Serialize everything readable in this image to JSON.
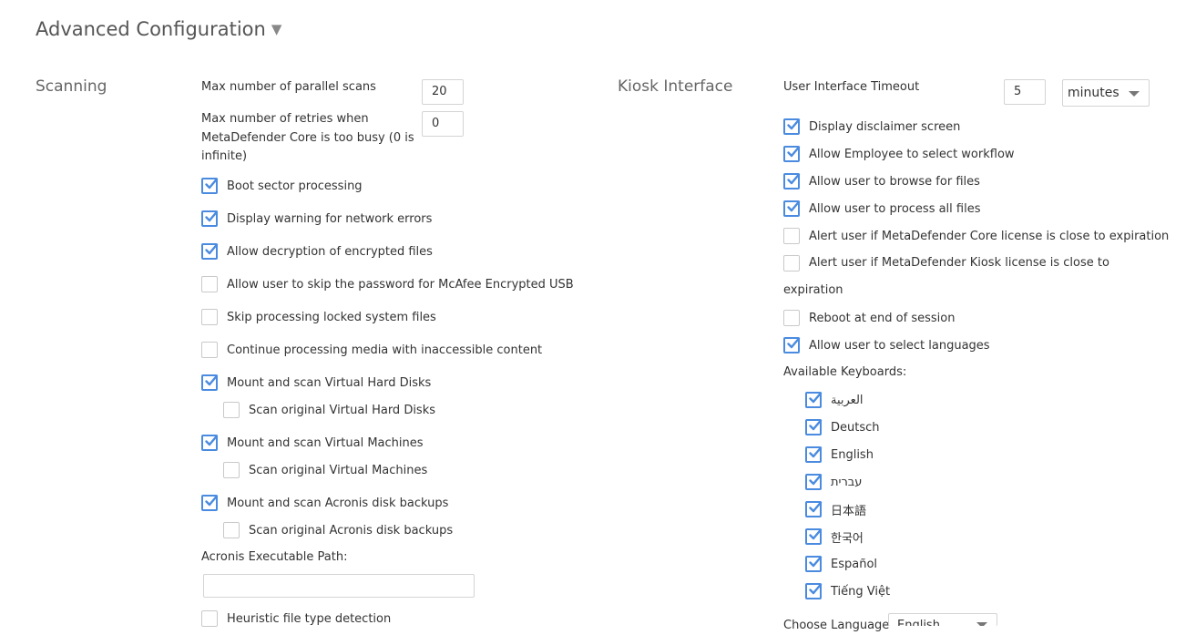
{
  "page": {
    "title": "Advanced Configuration",
    "title_caret": "▼"
  },
  "scanning": {
    "heading": "Scanning",
    "parallel_label": "Max number of parallel scans",
    "parallel_value": "20",
    "retries_label": "Max number of retries when MetaDefender Core is too busy (0 is infinite)",
    "retries_value": "0",
    "options": [
      {
        "label": "Boot sector processing",
        "checked": true
      },
      {
        "label": "Display warning for network errors",
        "checked": true
      },
      {
        "label": "Allow decryption of encrypted files",
        "checked": true
      },
      {
        "label": "Allow user to skip the password for McAfee Encrypted USB",
        "checked": false
      },
      {
        "label": "Skip processing locked system files",
        "checked": false
      },
      {
        "label": "Continue processing media with inaccessible content",
        "checked": false
      },
      {
        "label": "Mount and scan Virtual Hard Disks",
        "checked": true
      },
      {
        "label": "Scan original Virtual Hard Disks",
        "checked": false
      },
      {
        "label": "Mount and scan Virtual Machines",
        "checked": true
      },
      {
        "label": "Scan original Virtual Machines",
        "checked": false
      },
      {
        "label": "Mount and scan Acronis disk backups",
        "checked": true
      },
      {
        "label": "Scan original Acronis disk backups",
        "checked": false
      },
      {
        "label": "Heuristic file type detection",
        "checked": false
      }
    ],
    "acronis_path_label": "Acronis Executable Path:",
    "acronis_path_value": ""
  },
  "kiosk": {
    "heading": "Kiosk Interface",
    "timeout_label": "User Interface Timeout",
    "timeout_value": "5",
    "timeout_unit": "minutes",
    "options": [
      {
        "label": "Display disclaimer screen",
        "checked": true
      },
      {
        "label": "Allow Employee to select workflow",
        "checked": true
      },
      {
        "label": "Allow user to browse for files",
        "checked": true
      },
      {
        "label": "Allow user to process all files",
        "checked": true
      },
      {
        "label": "Alert user if MetaDefender Core license is close to expiration",
        "checked": false
      },
      {
        "label": "Alert user if MetaDefender Kiosk license is close to expiration",
        "checked": false
      },
      {
        "label": "Reboot at end of session",
        "checked": false
      },
      {
        "label": "Allow user to select languages",
        "checked": true
      }
    ],
    "keyboards_label": "Available Keyboards:",
    "keyboards": [
      {
        "label": "العربية",
        "checked": true
      },
      {
        "label": "Deutsch",
        "checked": true
      },
      {
        "label": "English",
        "checked": true
      },
      {
        "label": "עברית",
        "checked": true
      },
      {
        "label": "日本語",
        "checked": true
      },
      {
        "label": "한국어",
        "checked": true
      },
      {
        "label": "Español",
        "checked": true
      },
      {
        "label": "Tiếng Việt",
        "checked": true
      }
    ],
    "choose_language_label": "Choose Language",
    "choose_language_value": "English"
  },
  "colors": {
    "check_accent": "#4a8be0"
  }
}
